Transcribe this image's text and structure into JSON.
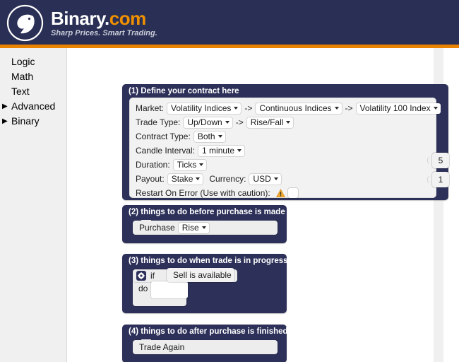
{
  "header": {
    "brand_name": "Binary",
    "brand_dot": ".",
    "brand_suffix": "com",
    "tagline": "Sharp Prices. Smart Trading.",
    "logo_icon": "binary-bird-logo-icon",
    "bg_color": "#2a3055",
    "accent_color": "#e98300"
  },
  "sidebar": {
    "items": [
      {
        "label": "Logic",
        "expandable": false
      },
      {
        "label": "Math",
        "expandable": false
      },
      {
        "label": "Text",
        "expandable": false
      },
      {
        "label": "Advanced",
        "expandable": true,
        "arrow": "▶"
      },
      {
        "label": "Binary",
        "expandable": true,
        "arrow": "▶"
      }
    ]
  },
  "workspace": {
    "block1": {
      "title": "(1) Define your contract here",
      "rows": {
        "market": {
          "label": "Market:",
          "value1": "Volatility Indices",
          "sep1": "->",
          "value2": "Continuous Indices",
          "sep2": "->",
          "value3": "Volatility 100 Index"
        },
        "trade_type": {
          "label": "Trade Type:",
          "value1": "Up/Down",
          "sep1": "->",
          "value2": "Rise/Fall"
        },
        "contract_type": {
          "label": "Contract Type:",
          "value": "Both"
        },
        "candle_interval": {
          "label": "Candle Interval:",
          "value": "1 minute"
        },
        "duration": {
          "label": "Duration:",
          "value": "Ticks"
        },
        "payout": {
          "label": "Payout:",
          "value": "Stake",
          "currency_label": "Currency:",
          "currency_value": "USD"
        },
        "restart_on_error": {
          "label": "Restart On Error (Use with caution):",
          "warn_icon": "warning-triangle-icon",
          "checked": false
        }
      }
    },
    "block2": {
      "title": "(2) things to do before purchase is made",
      "statement": {
        "label": "Purchase",
        "value": "Rise"
      }
    },
    "block3": {
      "title": "(3) things to do when trade is in progress",
      "if_block": {
        "gear_icon": "gear-icon",
        "if_label": "if",
        "do_label": "do",
        "condition": "Sell is available"
      }
    },
    "block4": {
      "title": "(4) things to do after purchase is finished",
      "statement": {
        "label": "Trade Again"
      }
    },
    "floating_numbers": [
      {
        "value": "5"
      },
      {
        "value": "1"
      }
    ]
  }
}
